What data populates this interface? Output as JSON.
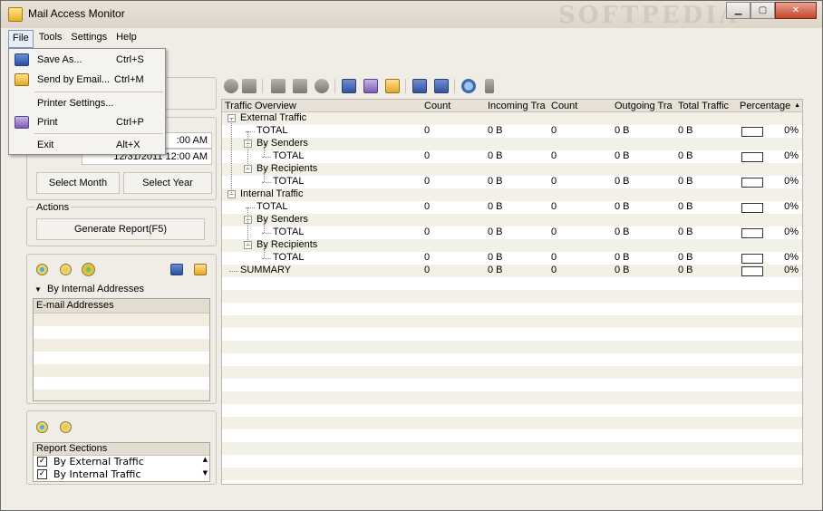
{
  "window": {
    "title": "Mail Access Monitor",
    "watermark": "SOFTPEDIA"
  },
  "menubar": [
    "File",
    "Tools",
    "Settings",
    "Help"
  ],
  "file_menu": {
    "items": [
      {
        "label": "Save As...",
        "shortcut": "Ctrl+S",
        "icon": "save-icon"
      },
      {
        "label": "Send by Email...",
        "shortcut": "Ctrl+M",
        "icon": "email-icon"
      },
      {
        "label": "Printer Settings...",
        "shortcut": "",
        "icon": ""
      },
      {
        "label": "Print",
        "shortcut": "Ctrl+P",
        "icon": "print-icon"
      },
      {
        "label": "Exit",
        "shortcut": "Alt+X",
        "icon": ""
      }
    ]
  },
  "period": {
    "from_time": ":00 AM",
    "to_value": "12/31/2011 12:00 AM",
    "select_month": "Select Month",
    "select_year": "Select Year"
  },
  "actions": {
    "title": "Actions",
    "generate": "Generate Report(F5)"
  },
  "filter": {
    "dropdown_label": "By Internal Addresses",
    "list_header": "E-mail Addresses"
  },
  "sections": {
    "header": "Report Sections",
    "items": [
      {
        "label": "By External Traffic",
        "checked": true
      },
      {
        "label": "By Internal Traffic",
        "checked": true
      }
    ]
  },
  "grid": {
    "columns": [
      "Traffic Overview",
      "Count",
      "Incoming Traf",
      "Count",
      "Outgoing Traf",
      "Total Traffic",
      "Percentage"
    ],
    "rows": [
      {
        "name": "External Traffic",
        "level": 0,
        "values": null
      },
      {
        "name": "TOTAL",
        "level": 1,
        "values": [
          "0",
          "0 B",
          "0",
          "0 B",
          "0 B",
          "0%"
        ]
      },
      {
        "name": "By Senders",
        "level": 1,
        "values": null
      },
      {
        "name": "TOTAL",
        "level": 2,
        "values": [
          "0",
          "0 B",
          "0",
          "0 B",
          "0 B",
          "0%"
        ]
      },
      {
        "name": "By Recipients",
        "level": 1,
        "values": null
      },
      {
        "name": "TOTAL",
        "level": 2,
        "values": [
          "0",
          "0 B",
          "0",
          "0 B",
          "0 B",
          "0%"
        ]
      },
      {
        "name": "Internal Traffic",
        "level": 0,
        "values": null
      },
      {
        "name": "TOTAL",
        "level": 1,
        "values": [
          "0",
          "0 B",
          "0",
          "0 B",
          "0 B",
          "0%"
        ]
      },
      {
        "name": "By Senders",
        "level": 1,
        "values": null
      },
      {
        "name": "TOTAL",
        "level": 2,
        "values": [
          "0",
          "0 B",
          "0",
          "0 B",
          "0 B",
          "0%"
        ]
      },
      {
        "name": "By Recipients",
        "level": 1,
        "values": null
      },
      {
        "name": "TOTAL",
        "level": 2,
        "values": [
          "0",
          "0 B",
          "0",
          "0 B",
          "0 B",
          "0%"
        ]
      },
      {
        "name": "SUMMARY",
        "level": 0,
        "values": [
          "0",
          "0 B",
          "0",
          "0 B",
          "0 B",
          "0%"
        ]
      }
    ]
  }
}
